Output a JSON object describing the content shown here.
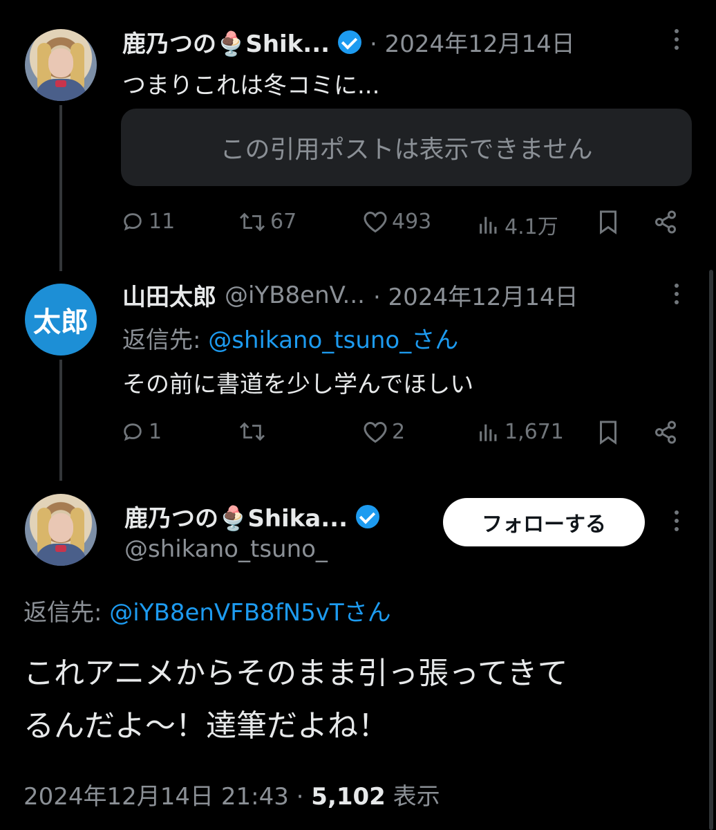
{
  "tweet1": {
    "name": "鹿乃つの🍨Shik...",
    "date": "· 2024年12月14日",
    "text": "つまりこれは冬コミに...",
    "quote_unavailable": "この引用ポストは表示できません",
    "replies": "11",
    "reposts": "67",
    "likes": "493",
    "views": "4.1万"
  },
  "tweet2": {
    "avatar_text": "太郎",
    "name": "山田太郎",
    "handle": "@iYB8enV...",
    "date": "· 2024年12月14日",
    "reply_to_label": "返信先:",
    "reply_to_user": "@shikano_tsuno_さん",
    "text": "その前に書道を少し学んでほしい",
    "replies": "1",
    "reposts": "",
    "likes": "2",
    "views": "1,671"
  },
  "main": {
    "name": "鹿乃つの🍨Shika...",
    "handle": "@shikano_tsuno_",
    "follow_label": "フォローする",
    "reply_to_label": "返信先:",
    "reply_to_user": "@iYB8enVFB8fN5vTさん",
    "text_line1": "これアニメからそのまま引っ張ってきて",
    "text_line2": "るんだよ～！達筆だよね！",
    "timestamp": "2024年12月14日 21:43 · ",
    "view_count": "5,102",
    "view_label": " 表示"
  },
  "colors": {
    "accent": "#1d9bf0",
    "background": "#000000",
    "text": "#e7e9ea",
    "muted": "#71767b"
  },
  "icons": [
    "reply-icon",
    "repost-icon",
    "like-icon",
    "views-icon",
    "bookmark-icon",
    "share-icon",
    "verified-badge-icon",
    "more-icon"
  ]
}
